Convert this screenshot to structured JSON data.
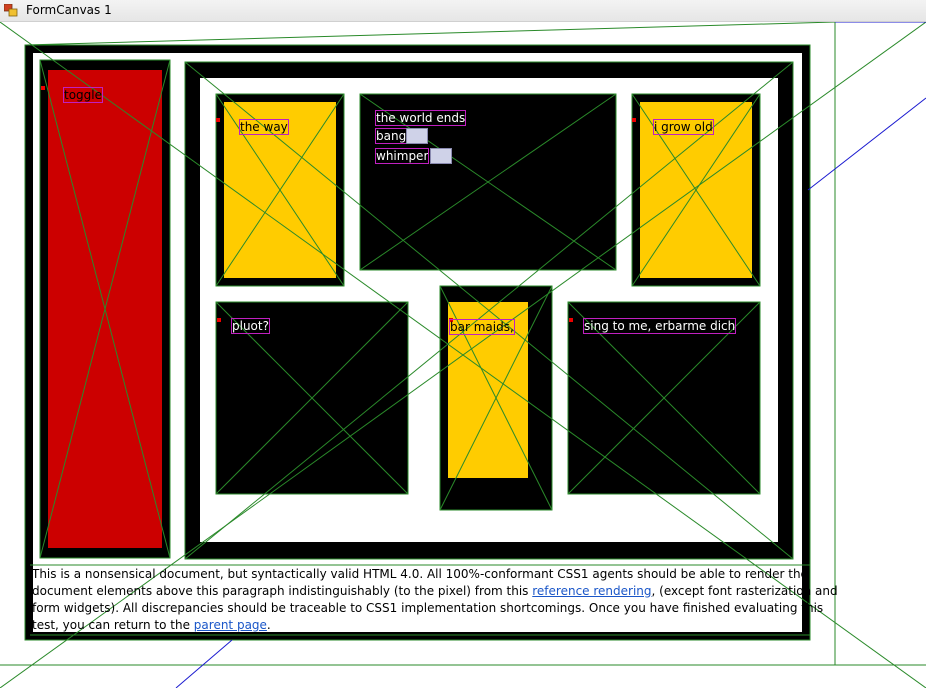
{
  "window": {
    "title": "FormCanvas 1"
  },
  "colors": {
    "black": "#000000",
    "white": "#ffffff",
    "red": "#cc0000",
    "yellow": "#ffcc00",
    "green_lines": "#2a7a2a",
    "blue_lines": "#1a1ad0"
  },
  "boxes": {
    "toggle": {
      "label": "toggle"
    },
    "the_way": {
      "label": "the way"
    },
    "world": {
      "label1": "the world ends",
      "label2": "bang",
      "label3": "whimper"
    },
    "grow_old": {
      "label": "i grow old"
    },
    "pluot": {
      "label": "pluot?"
    },
    "bar_maids": {
      "label": "bar maids,"
    },
    "sing": {
      "label": "sing to me, erbarme dich"
    }
  },
  "paragraph": {
    "line1": "This is a nonsensical document, but syntactically valid HTML 4.0. All 100%-conformant CSS1 agents should be able to render the",
    "line2a": "document elements above this paragraph indistinguishably (to the pixel) from this ",
    "link1": "reference rendering",
    "line2b": ", (except font rasterization and",
    "line3": "form widgets). All discrepancies should be traceable to CSS1 implementation shortcomings. Once you have finished evaluating this",
    "line4a": "test, you can return to the ",
    "link2": "parent page",
    "line4b": "."
  }
}
